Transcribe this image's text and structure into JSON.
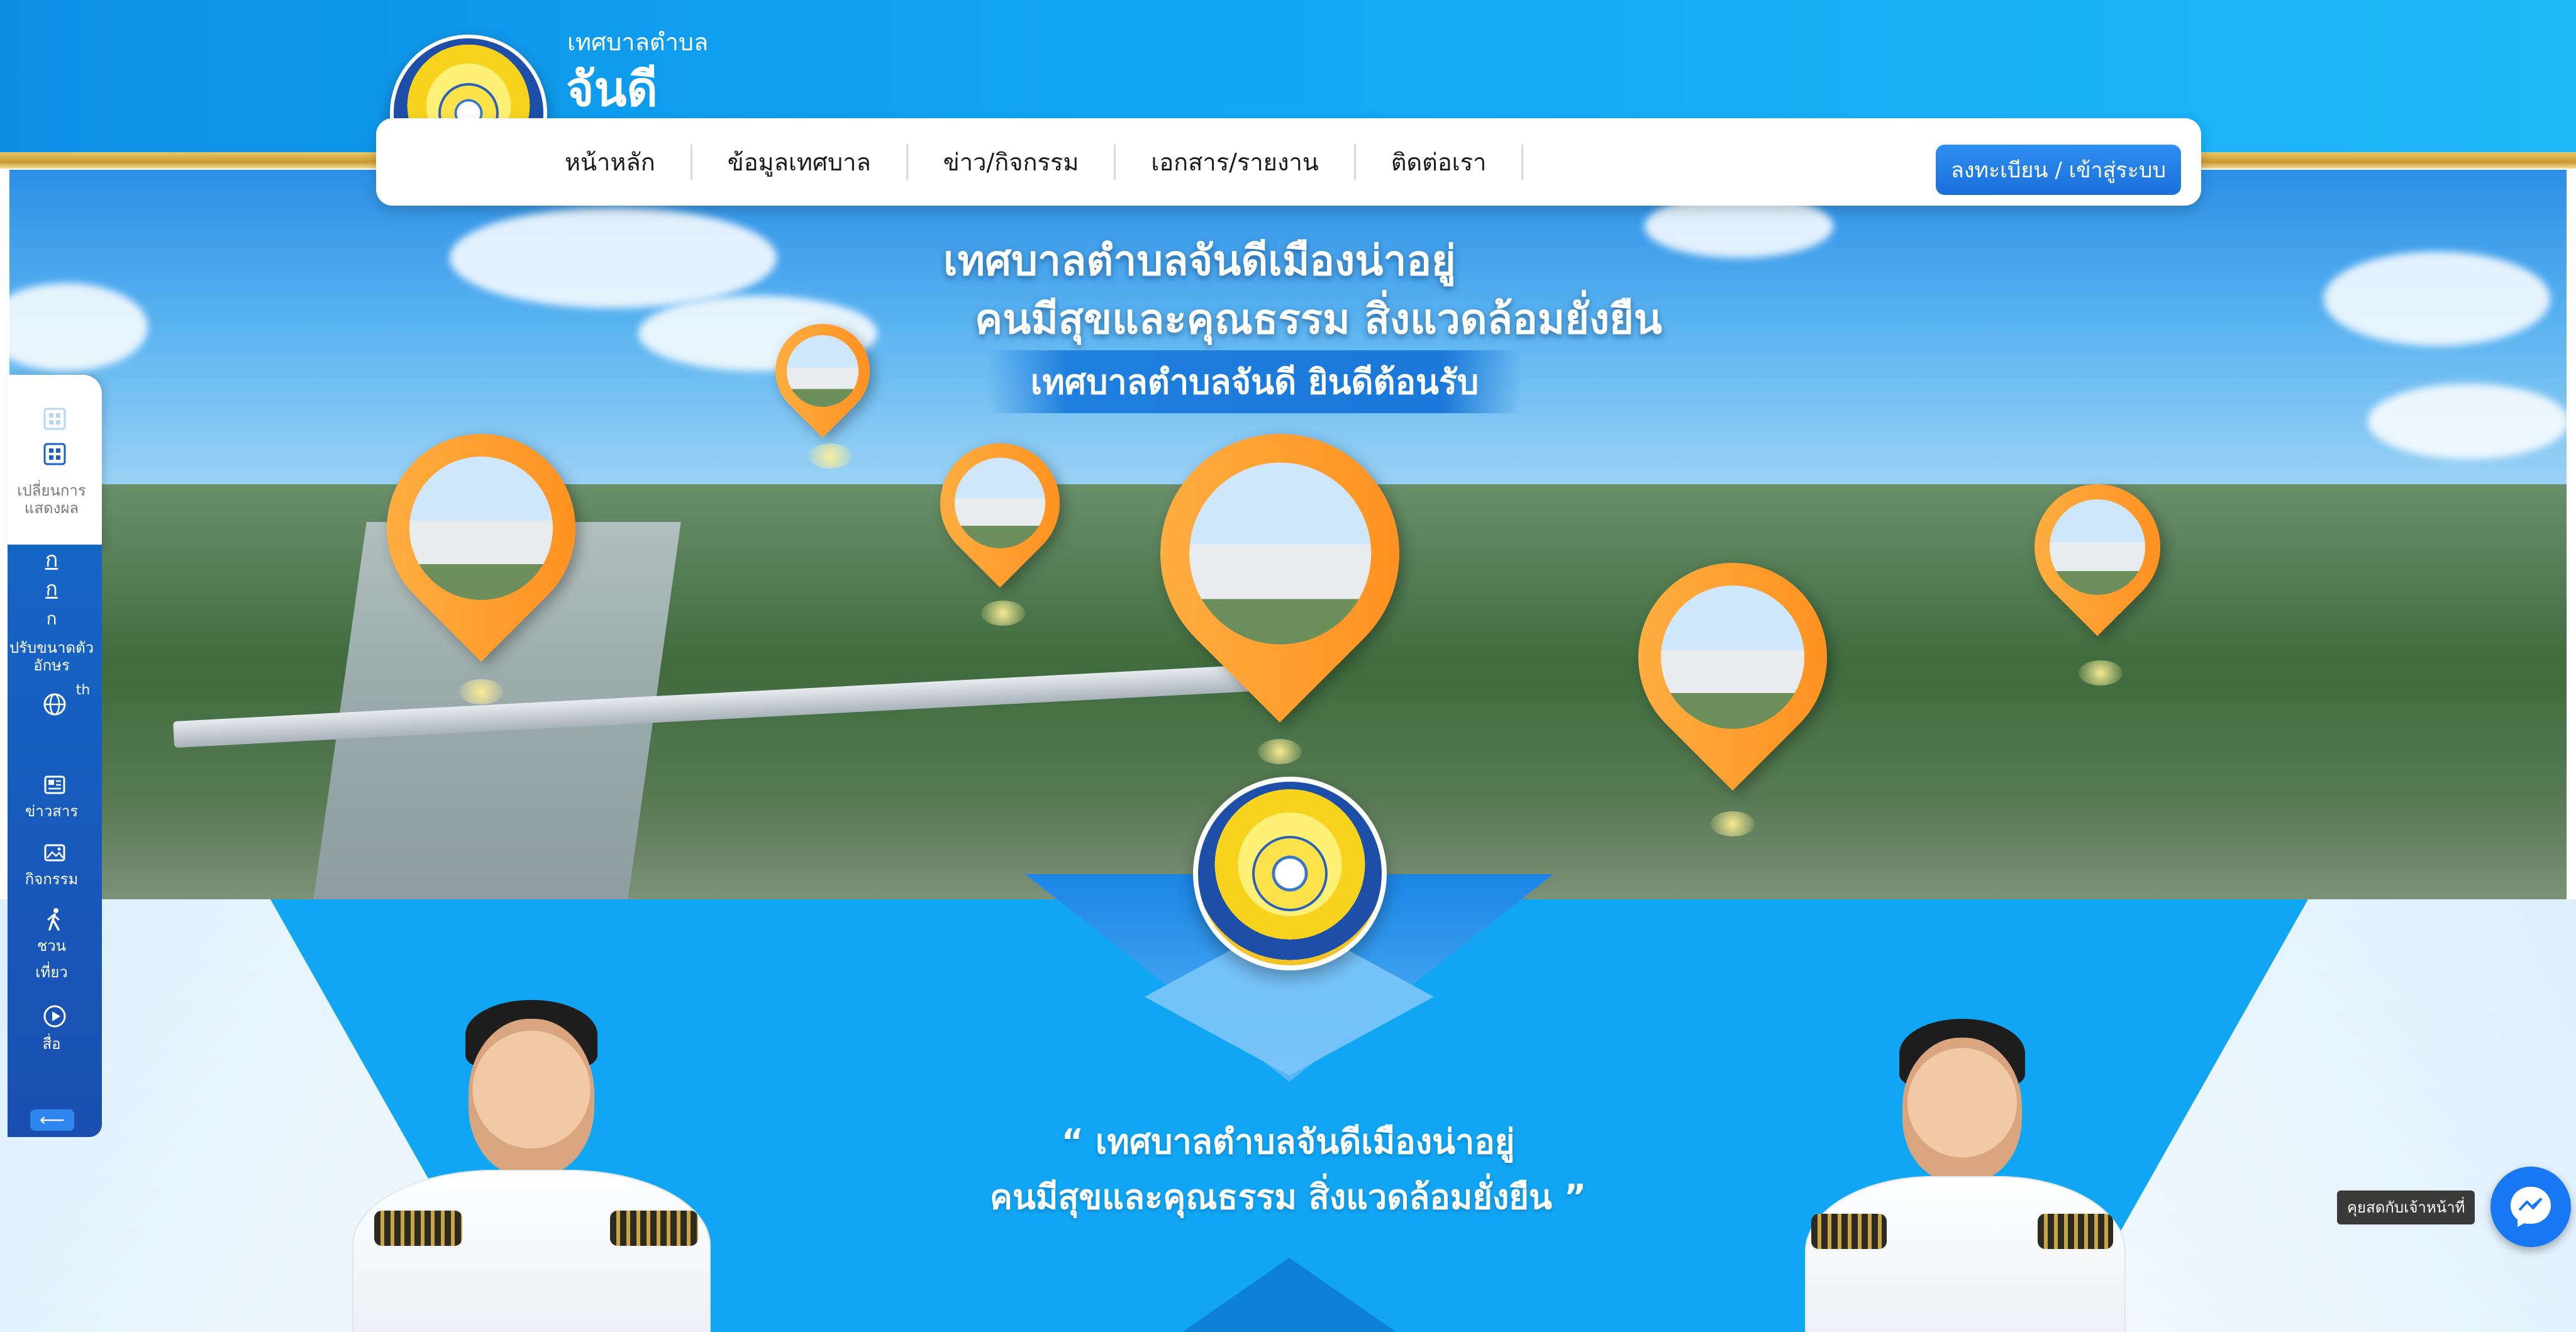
{
  "header": {
    "site_subtitle": "เทศบาลตำบล",
    "site_title": "จันดี"
  },
  "nav": {
    "items": [
      {
        "label": "หน้าหลัก"
      },
      {
        "label": "ข้อมูลเทศบาล"
      },
      {
        "label": "ข่าว/กิจกรรม"
      },
      {
        "label": "เอกสาร/รายงาน"
      },
      {
        "label": "ติดต่อเรา"
      }
    ],
    "login_label": "ลงทะเบียน / เข้าสู่ระบบ"
  },
  "hero": {
    "headline_1": "เทศบาลตำบลจันดีเมืองน่าอยู่",
    "headline_2": "คนมีสุขและคุณธรรม สิ่งแวดล้อมยั่งยืน",
    "welcome": "เทศบาลตำบลจันดี ยินดีต้อนรับ"
  },
  "quote": {
    "line_1": "“ เทศบาลตำบลจันดีเมืองน่าอยู่",
    "line_2": "คนมีสุขและคุณธรรม สิ่งแวดล้อมยั่งยืน ”"
  },
  "side_toolbar": {
    "display_label": "เปลี่ยนการแสดงผล",
    "font_glyph_1": "ก",
    "font_glyph_2": "ก",
    "font_glyph_3": "ก",
    "font_label": "ปรับขนาดตัวอักษร",
    "lang_code": "th",
    "news_label": "ข่าวสาร",
    "activity_label": "กิจกรรม",
    "travel_label_1": "ชวน",
    "travel_label_2": "เที่ยว",
    "media_label": "สื่อ",
    "collapse_glyph": "⟵"
  },
  "chat": {
    "label": "คุยสดกับเจ้าหน้าที่"
  },
  "colors": {
    "primary_blue": "#11a6f4",
    "nav_button": "#1a6fd8",
    "pin_orange": "#ff8c1a",
    "gold": "#c99a32",
    "messenger": "#1877f2"
  }
}
